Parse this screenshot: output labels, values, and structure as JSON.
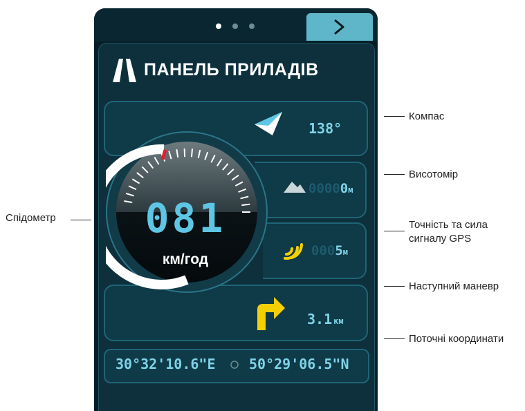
{
  "pager": {
    "dots": 3,
    "active": 0
  },
  "header": {
    "title": "ПАНЕЛЬ ПРИЛАДІВ",
    "icon": "road-icon"
  },
  "compass": {
    "value": "138°",
    "icon": "compass-arrow-icon"
  },
  "altitude": {
    "dim_digits": "0000",
    "value": "0",
    "unit": "м",
    "icon": "mountain-icon"
  },
  "gps": {
    "dim_digits": "000",
    "value": "5",
    "unit": "м",
    "icon": "gps-signal-icon"
  },
  "speedometer": {
    "value": "081",
    "unit": "км/год",
    "needle_color": "#e0202e"
  },
  "maneuver": {
    "distance": "3.1",
    "unit": "км",
    "icon": "turn-right-arrow-icon"
  },
  "coordinates": {
    "longitude": "30°32'10.6\"E",
    "latitude": "50°29'06.5\"N",
    "separator_icon": "circle-separator-icon"
  },
  "annotations": {
    "compass": "Компас",
    "altimeter": "Висотомір",
    "gps_line1": "Точність та сила",
    "gps_line2": "сигналу GPS",
    "maneuver": "Наступний маневр",
    "coordinates": "Поточні координати",
    "speedometer": "Спідометр"
  },
  "colors": {
    "accent": "#5ec6e4",
    "background": "#071e27",
    "turn_arrow": "#f5d000"
  }
}
